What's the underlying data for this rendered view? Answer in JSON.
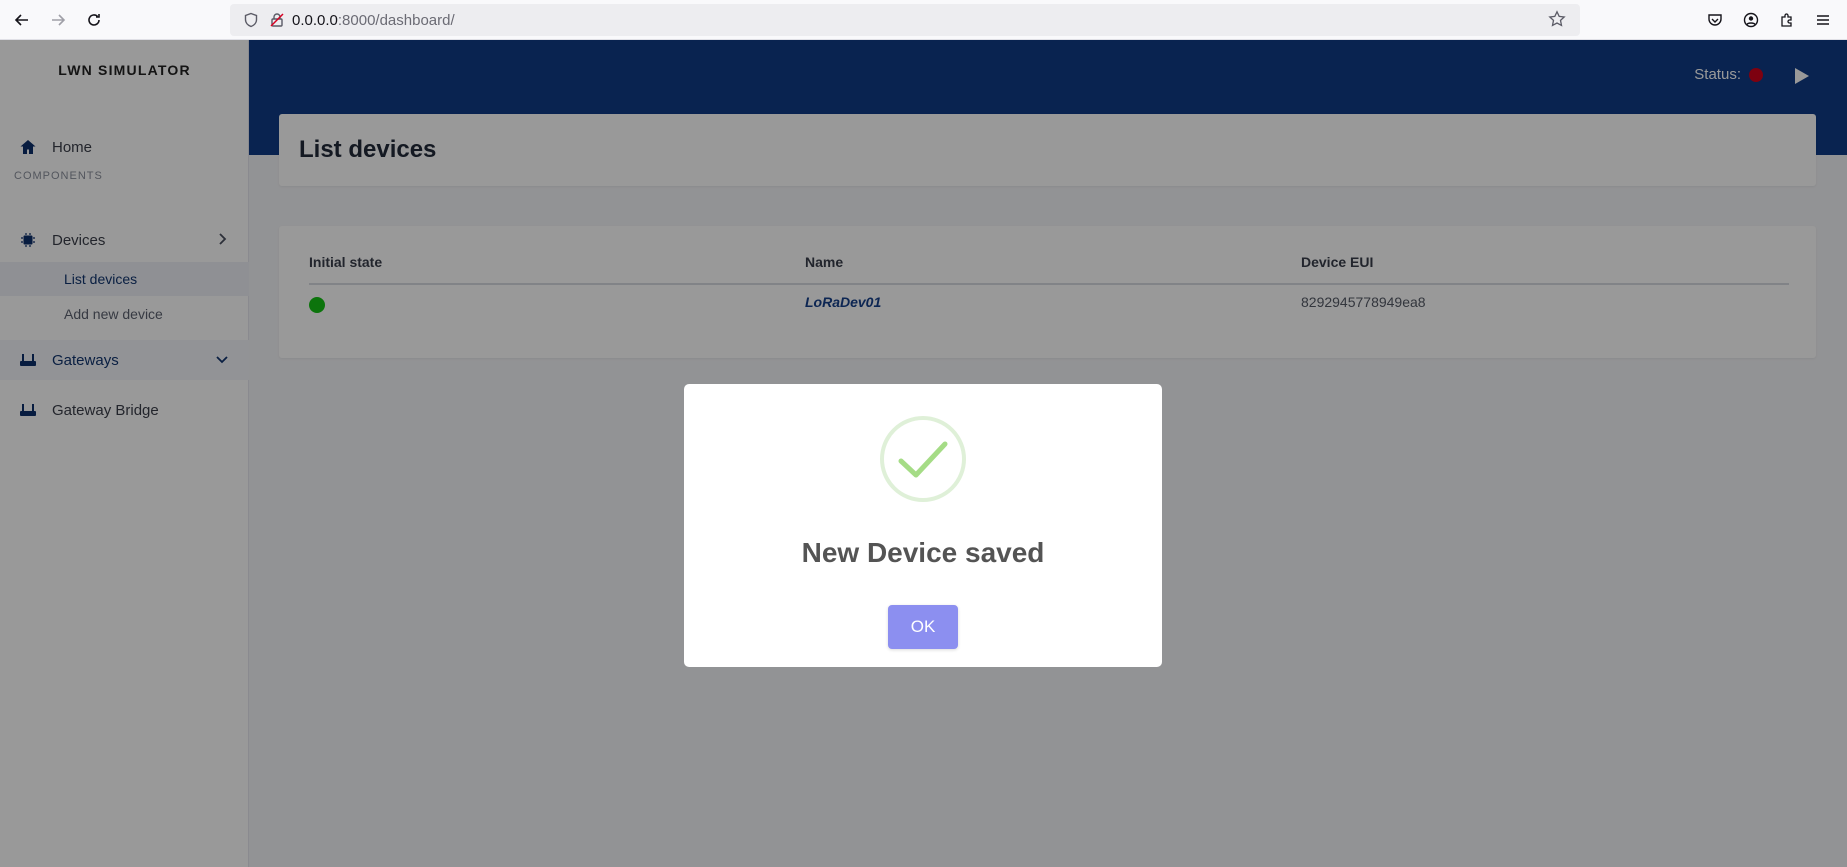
{
  "browser": {
    "url_host": "0.0.0.0",
    "url_rest": ":8000/dashboard/"
  },
  "sidebar": {
    "brand": "LWN SIMULATOR",
    "home": "Home",
    "section": "COMPONENTS",
    "devices": "Devices",
    "list_devices": "List devices",
    "add_device": "Add new device",
    "gateways": "Gateways",
    "gateway_bridge": "Gateway Bridge"
  },
  "topbar": {
    "status_label": "Status:",
    "status_color": "#d0021b"
  },
  "page": {
    "title": "List devices"
  },
  "table": {
    "columns": [
      "Initial state",
      "Name",
      "Device EUI"
    ],
    "rows": [
      {
        "state_color": "#15c215",
        "name": "LoRaDev01",
        "eui": "8292945778949ea8"
      }
    ]
  },
  "modal": {
    "icon": "success-check-icon",
    "title": "New Device saved",
    "ok_label": "OK"
  }
}
